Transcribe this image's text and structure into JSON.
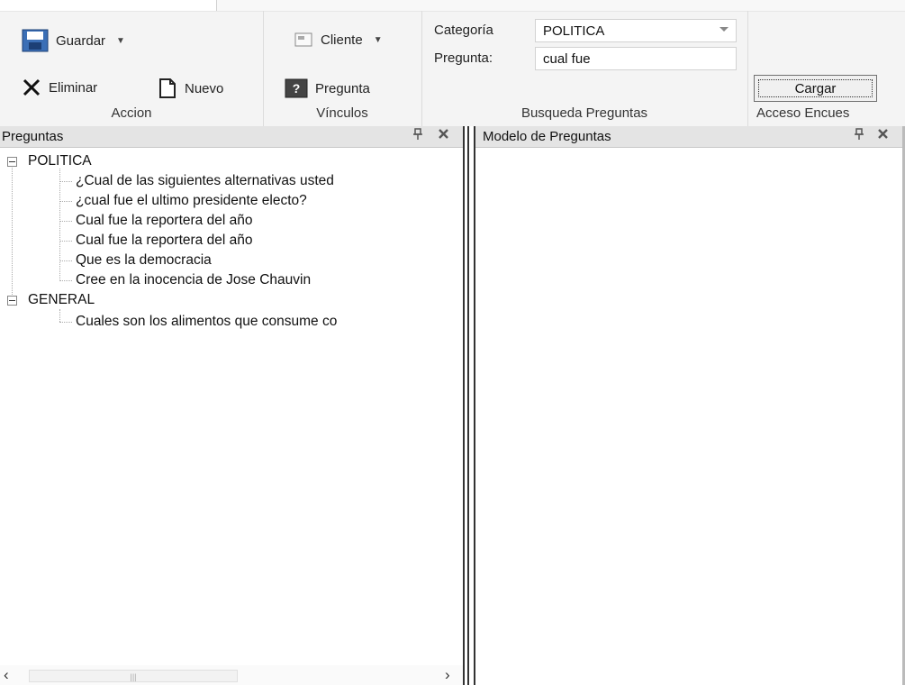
{
  "ribbon": {
    "groups": {
      "accion": {
        "label": "Accion",
        "save_label": "Guardar",
        "delete_label": "Eliminar",
        "new_label": "Nuevo"
      },
      "vinculos": {
        "label": "Vínculos",
        "client_label": "Cliente",
        "question_label": "Pregunta"
      },
      "busqueda": {
        "label": "Busqueda Preguntas",
        "category_label": "Categoría",
        "category_value": "POLITICA",
        "question_label": "Pregunta:",
        "question_value": "cual fue"
      },
      "acceso": {
        "label": "Acceso Encues",
        "load_label": "Cargar"
      }
    }
  },
  "preguntas_panel": {
    "title": "Preguntas",
    "pin_icon": "pin-icon",
    "close_icon": "close-icon",
    "tree": [
      {
        "category": "POLITICA",
        "items": [
          "¿Cual de las siguientes alternativas usted",
          "¿cual fue el ultimo presidente electo?",
          "Cual fue la reportera del año",
          "Cual fue la reportera del año",
          "Que es la democracia",
          "Cree en la inocencia de Jose Chauvin"
        ]
      },
      {
        "category": "GENERAL",
        "items": [
          "Cuales son los alimentos que consume co"
        ]
      }
    ]
  },
  "modelo_panel": {
    "title": "Modelo de Preguntas"
  },
  "colors": {
    "ribbon_bg": "#f4f4f4",
    "panel_header_bg": "#e4e4e4",
    "splitter": "#333333"
  }
}
